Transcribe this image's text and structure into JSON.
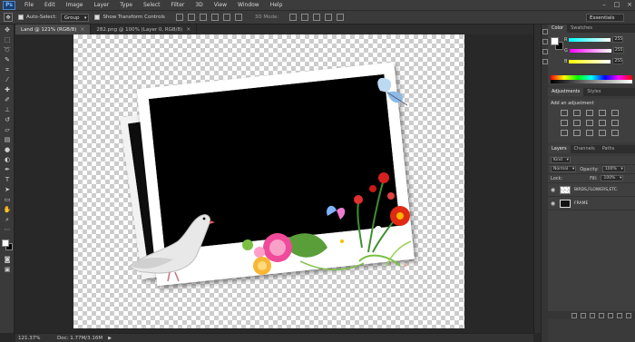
{
  "app": {
    "logo": "Ps",
    "menu": [
      "File",
      "Edit",
      "Image",
      "Layer",
      "Type",
      "Select",
      "Filter",
      "3D",
      "View",
      "Window",
      "Help"
    ]
  },
  "options": {
    "auto_select_label": "Auto-Select:",
    "auto_select_value": "Group",
    "transform_label": "Show Transform Controls",
    "mode_3d": "3D Mode:",
    "workspace": "Essentials"
  },
  "tabs": [
    {
      "label": "Land @ 121% (RGB/8)",
      "active": true
    },
    {
      "label": "282.png @ 100% (Layer 0, RGB/8)",
      "active": false
    }
  ],
  "tab_close": "×",
  "status": {
    "zoom": "121.37%",
    "doc": "Doc: 1.77M/3.16M",
    "arrow": "▶"
  },
  "panels": {
    "color_tabs": [
      "Color",
      "Swatches"
    ],
    "sliders": [
      {
        "label": "R",
        "value": "255"
      },
      {
        "label": "G",
        "value": "255"
      },
      {
        "label": "B",
        "value": "255"
      }
    ],
    "adj_tabs": [
      "Adjustments",
      "Styles"
    ],
    "adj_title": "Add an adjustment",
    "layer_tabs": [
      "Layers",
      "Channels",
      "Paths"
    ],
    "kind": "Kind",
    "blend": "Normal",
    "opacity_label": "Opacity:",
    "opacity_value": "100%",
    "lock_label": "Lock:",
    "fill_label": "Fill:",
    "fill_value": "100%",
    "layers": [
      {
        "name": "BIRDS,FLOWERS,ETC.",
        "thumb": "checker"
      },
      {
        "name": "FRAME",
        "thumb": "dark"
      }
    ]
  },
  "colors": {
    "background": "#282828",
    "panel": "#3a3a3a",
    "accent": "#1a3f72"
  }
}
